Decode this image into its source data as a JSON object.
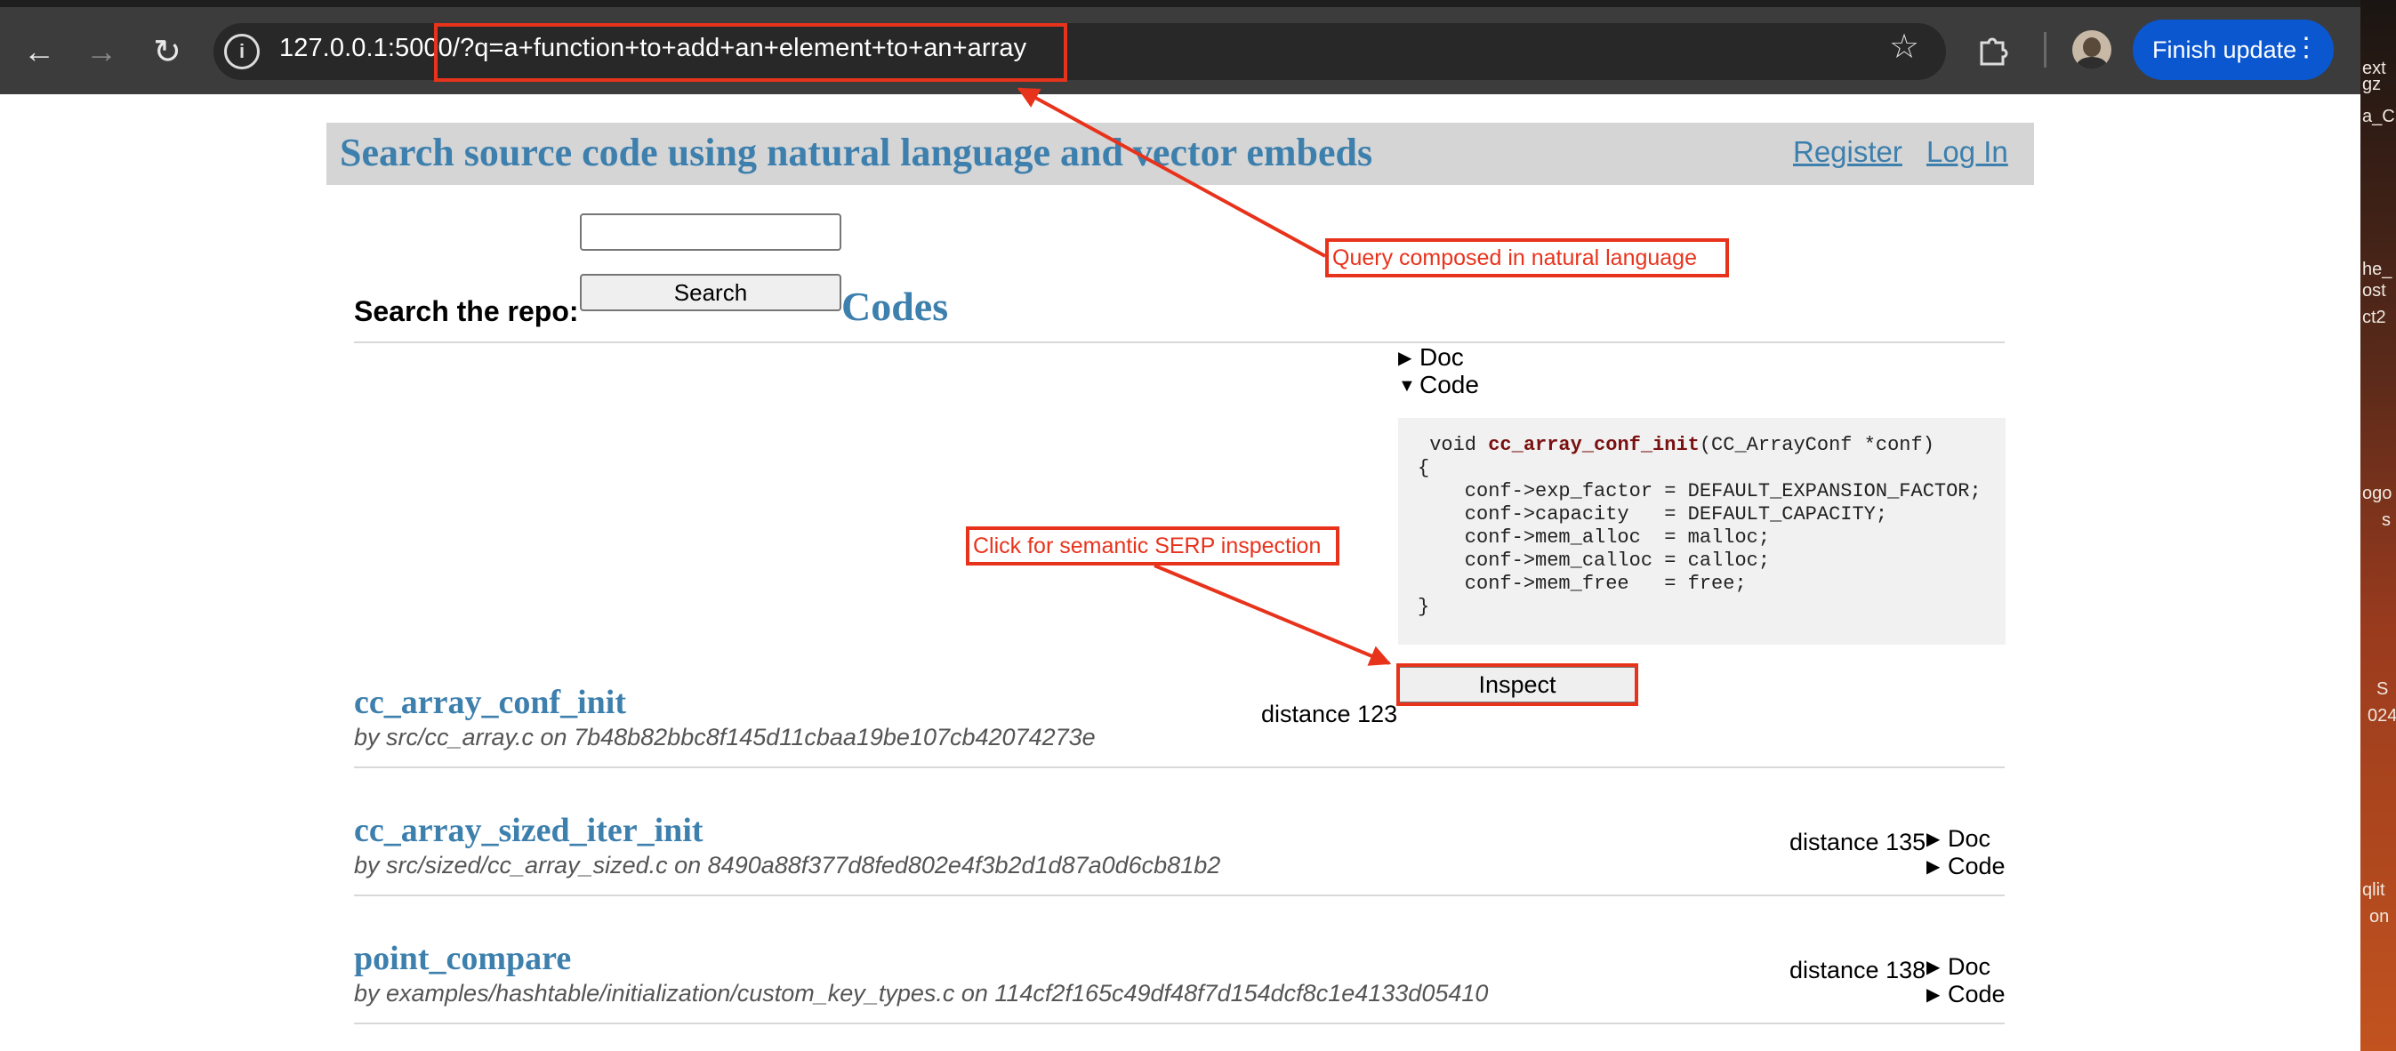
{
  "browser": {
    "url": "127.0.0.1:5000/?q=a+function+to+add+an+element+to+an+array",
    "finish_update_label": "Finish update",
    "icons": [
      "back-arrow-icon",
      "forward-arrow-icon",
      "reload-icon",
      "site-info-icon",
      "bookmark-star-icon",
      "extensions-puzzle-icon",
      "profile-avatar",
      "kebab-menu-icon"
    ]
  },
  "desktop_strip": {
    "fragments": [
      "ext",
      "gz",
      "a_C",
      "he_",
      "ost",
      "ct2",
      "ogo",
      "s",
      "S",
      "024",
      "qlit",
      "on"
    ]
  },
  "header": {
    "title": "Search source code using natural language and vector embeds",
    "register": "Register",
    "login": "Log In"
  },
  "search": {
    "label": "Search the repo:",
    "input_value": "",
    "button_label": "Search"
  },
  "codes_heading": "Codes",
  "top_result_panel": {
    "doc_label": "Doc",
    "code_label": "Code",
    "code_lines": {
      "l1_prefix": " void ",
      "l1_fn": "cc_array_conf_init",
      "l1_suffix": "(CC_ArrayConf *conf)",
      "rest": "{\n    conf->exp_factor = DEFAULT_EXPANSION_FACTOR;\n    conf->capacity   = DEFAULT_CAPACITY;\n    conf->mem_alloc  = malloc;\n    conf->mem_calloc = calloc;\n    conf->mem_free   = free;\n}"
    },
    "inspect_label": "Inspect"
  },
  "results": [
    {
      "title": "cc_array_conf_init",
      "meta": "by src/cc_array.c on 7b48b82bbc8f145d11cbaa19be107cb42074273e",
      "distance": "distance 123"
    },
    {
      "title": "cc_array_sized_iter_init",
      "meta": "by src/sized/cc_array_sized.c on 8490a88f377d8fed802e4f3b2d1d87a0d6cb81b2",
      "distance": "distance 135",
      "doc_label": "Doc",
      "code_label": "Code"
    },
    {
      "title": "point_compare",
      "meta": "by examples/hashtable/initialization/custom_key_types.c on 114cf2f165c49df48f7d154dcf8c1e4133d05410",
      "distance": "distance 138",
      "doc_label": "Doc",
      "code_label": "Code"
    }
  ],
  "annotations": {
    "query_note": "Query composed in natural language",
    "inspect_note": "Click for semantic SERP inspection",
    "color": "#e8331c"
  },
  "colors": {
    "link": "#3d7fad",
    "header_bar": "#d5d5d5",
    "chrome": "#3c3c3c",
    "update_button": "#0b57d0"
  }
}
